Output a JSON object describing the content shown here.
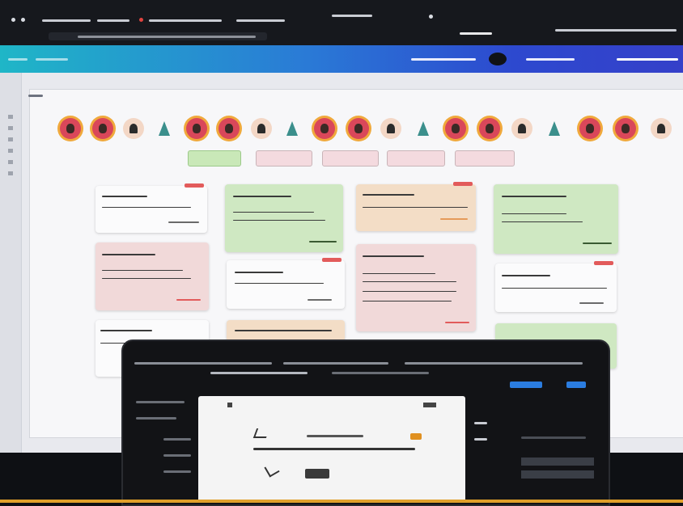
{
  "scene": {
    "description_colors": {
      "appbar_start": "#1fb6c7",
      "appbar_end": "#3540c9",
      "card_green": "#cfe8c2",
      "card_pink": "#f1d9d9",
      "card_tan": "#f3ddc6",
      "card_white": "#fbfbfc",
      "tag_red": "#e25b5b"
    },
    "avatar_icons": [
      "person-f",
      "person-f",
      "person-m",
      "person-a",
      "person-f",
      "person-f",
      "person-m",
      "person-a",
      "person-f",
      "person-f",
      "person-m",
      "person-a",
      "person-f",
      "person-f",
      "person-m",
      "person-a",
      "person-f",
      "person-f",
      "person-m"
    ],
    "filters": [
      {
        "active": true
      },
      {
        "active": false
      },
      {
        "active": false
      },
      {
        "active": false
      },
      {
        "active": false
      }
    ],
    "cards": [
      {
        "color": "white",
        "tag": true
      },
      {
        "color": "green",
        "tag": false
      },
      {
        "color": "tan",
        "tag": true
      },
      {
        "color": "green",
        "tag": false
      },
      {
        "color": "pink",
        "tag": false
      },
      {
        "color": "white",
        "tag": true
      },
      {
        "color": "pink",
        "tag": false
      },
      {
        "color": "white",
        "tag": true
      },
      {
        "color": "white",
        "tag": false
      },
      {
        "color": "tan",
        "tag": false
      },
      {
        "color": "green",
        "tag": false
      }
    ]
  }
}
